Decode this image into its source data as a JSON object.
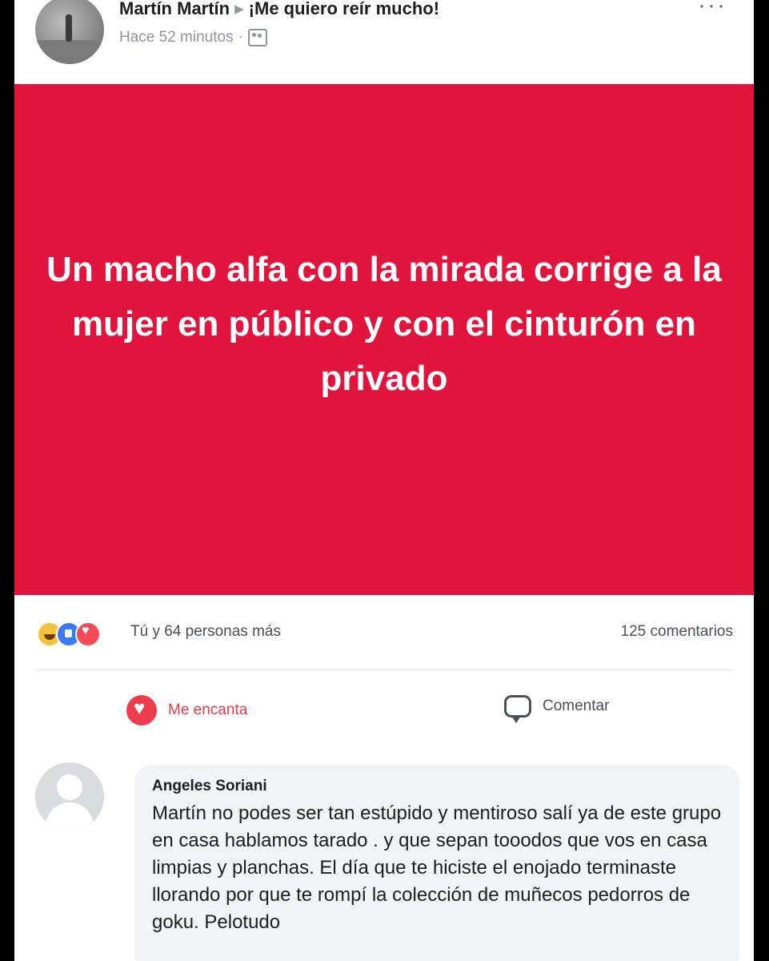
{
  "header": {
    "author": "Martín Martín",
    "group": "¡Me quiero reír mucho!",
    "time": "Hace 52 minutos",
    "separator": "·",
    "more": "···"
  },
  "post": {
    "image_text": "Un macho alfa con la mirada corrige a la mujer en público y con el cinturón en privado",
    "image_color": "#e0143c"
  },
  "reactions": {
    "icons": [
      "haha-icon",
      "like-icon",
      "love-icon"
    ],
    "summary": "Tú y 64 personas más",
    "comments": "125 comentarios"
  },
  "actions": {
    "love_label": "Me encanta",
    "comment_label": "Comentar"
  },
  "comment": {
    "author": "Angeles Soriani",
    "text": "Martín no podes ser tan estúpido y mentiroso salí ya de este grupo en casa hablamos tarado . y que sepan tooodos que vos en casa limpias y planchas. El día que te hiciste el enojado terminaste llorando por que te rompí la colección de muñecos pedorros de goku. Pelotudo"
  }
}
